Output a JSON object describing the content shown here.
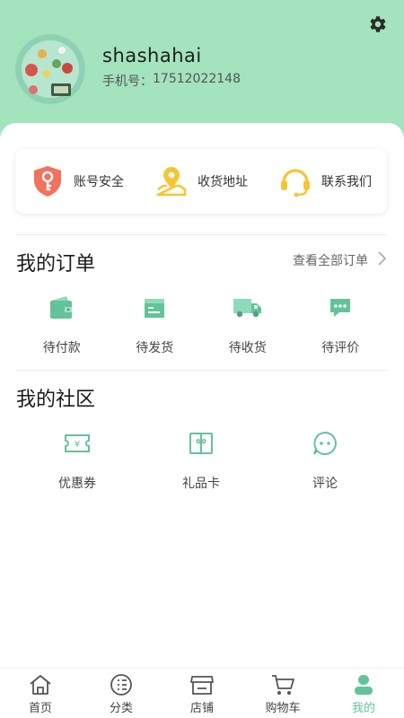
{
  "profile": {
    "username": "shashahai",
    "phone_label": "手机号：",
    "phone_number": "17512022148"
  },
  "quick_actions": [
    {
      "label": "账号安全",
      "icon": "shield-key-icon"
    },
    {
      "label": "收货地址",
      "icon": "location-pin-icon"
    },
    {
      "label": "联系我们",
      "icon": "headset-icon"
    }
  ],
  "orders": {
    "title": "我的订单",
    "view_all": "查看全部订单",
    "items": [
      {
        "label": "待付款",
        "icon": "wallet-icon"
      },
      {
        "label": "待发货",
        "icon": "package-icon"
      },
      {
        "label": "待收货",
        "icon": "truck-icon"
      },
      {
        "label": "待评价",
        "icon": "chat-bubble-icon"
      }
    ]
  },
  "community": {
    "title": "我的社区",
    "items": [
      {
        "label": "优惠券",
        "icon": "coupon-icon"
      },
      {
        "label": "礼品卡",
        "icon": "gift-card-icon"
      },
      {
        "label": "评论",
        "icon": "comment-icon"
      }
    ]
  },
  "tabbar": {
    "active": "我的",
    "items": [
      {
        "label": "首页",
        "icon": "home-icon"
      },
      {
        "label": "分类",
        "icon": "category-icon"
      },
      {
        "label": "店铺",
        "icon": "store-icon"
      },
      {
        "label": "购物车",
        "icon": "cart-icon"
      },
      {
        "label": "我的",
        "icon": "profile-icon"
      }
    ]
  },
  "colors": {
    "header_bg": "#a3e3bd",
    "accent_green": "#63c398",
    "shield_red": "#f0725f",
    "pin_yellow": "#f7c531"
  }
}
